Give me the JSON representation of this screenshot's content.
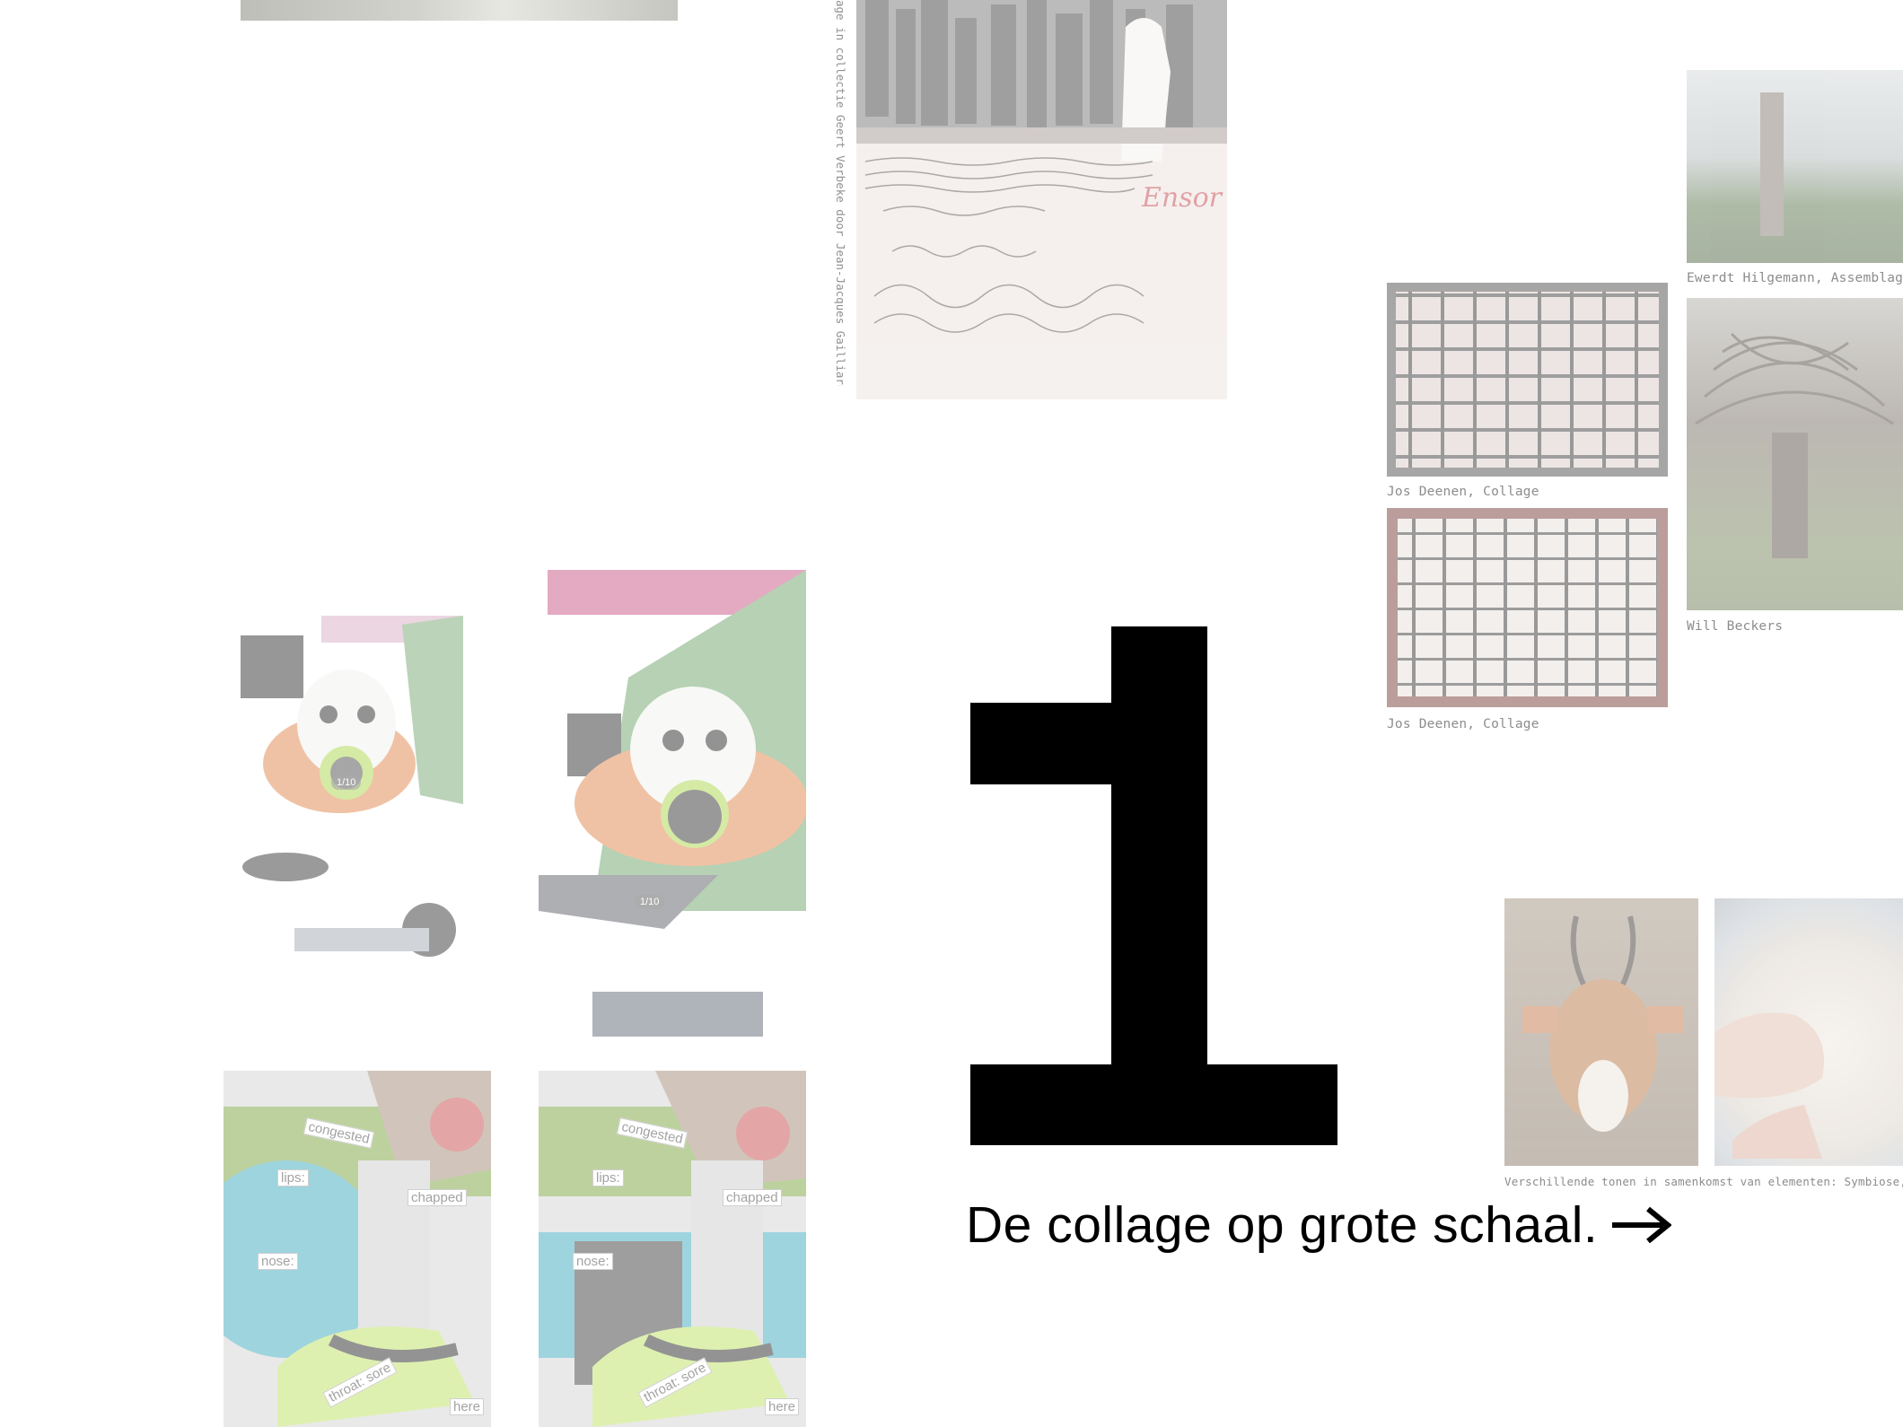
{
  "vertical_caption": "age in collectie Geert Verbeke door Jean-Jacques Gailliard",
  "gallery": {
    "hilgemann_caption": "Ewerdt Hilgemann, Assemblage",
    "beckers_caption": "Will Beckers",
    "deenen_top_caption": "Jos Deenen, Collage",
    "deenen_bottom_caption": "Jos Deenen, Collage",
    "symbiose_caption": "Verschillende tonen in samenkomst van elementen: Symbiose, Mi"
  },
  "ensor_postcard": {
    "signature": "Ensor",
    "handwriting_1": "Jean Jacques Gailliard",
    "handwriting_2": "Extrait du film",
    "handwriting_3": "Le Réveil d'Ensor"
  },
  "collage_left": {
    "counter_1": "1/10",
    "counter_2": "1/10",
    "words_1": [
      "congested",
      "lips:",
      "chapped",
      "nose:",
      "throat: sore",
      "here"
    ],
    "words_2": [
      "congested",
      "lips:",
      "chapped",
      "nose:",
      "throat: sore",
      "here"
    ]
  },
  "hero": {
    "number": "1",
    "headline": "De collage op grote schaal.",
    "arrow_icon": "arrow-right-icon"
  }
}
